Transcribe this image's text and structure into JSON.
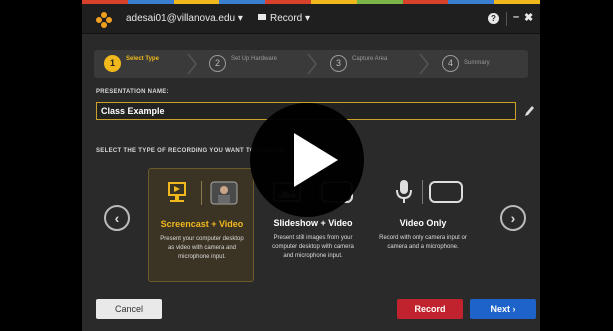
{
  "colors": {
    "stripe": [
      "#d7402b",
      "#3a7fd0",
      "#f0b81c",
      "#3a7fd0",
      "#d7402b",
      "#f0b81c",
      "#7ab548",
      "#d7402b",
      "#3a7fd0",
      "#f0b81c"
    ],
    "accent": "#f0b81c",
    "record": "#c0232d",
    "next": "#1d63c9"
  },
  "titlebar": {
    "account": "adesai01@villanova.edu ▾",
    "record_menu": "Record ▾",
    "help_icon": "?",
    "minimize_icon": "–",
    "close_icon": "✖"
  },
  "steps": [
    {
      "num": "1",
      "label": "Select Type"
    },
    {
      "num": "2",
      "label": "Set Up Hardware"
    },
    {
      "num": "3",
      "label": "Capture Area"
    },
    {
      "num": "4",
      "label": "Summary"
    }
  ],
  "presentation": {
    "label": "PRESENTATION NAME:",
    "value": "Class Example"
  },
  "recording_type": {
    "label": "SELECT THE TYPE OF RECORDING YOU WANT TO CREATE:",
    "prev_icon": "‹",
    "next_icon": "›",
    "options": [
      {
        "title": "Screencast + Video",
        "desc": "Present your computer desktop as video with camera and microphone input."
      },
      {
        "title": "Slideshow + Video",
        "desc": "Present still images from your computer desktop with camera and microphone input."
      },
      {
        "title": "Video Only",
        "desc": "Record with only camera input or camera and a microphone."
      }
    ]
  },
  "footer": {
    "cancel": "Cancel",
    "record": "Record",
    "next": "Next ›"
  }
}
